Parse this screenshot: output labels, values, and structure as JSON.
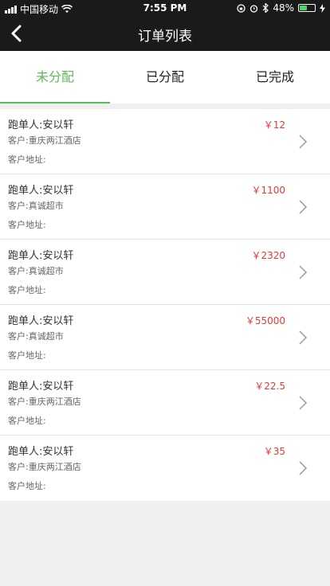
{
  "status": {
    "carrier": "中国移动",
    "time": "7:55 PM",
    "battery": "48%",
    "battery_level": 0.48
  },
  "nav": {
    "title": "订单列表"
  },
  "tabs": [
    {
      "label": "未分配",
      "active": true
    },
    {
      "label": "已分配",
      "active": false
    },
    {
      "label": "已完成",
      "active": false
    }
  ],
  "orders": [
    {
      "runner": "跑单人:安以轩",
      "customer": "客户:重庆两江酒店",
      "address": "客户地址:",
      "price": "￥12"
    },
    {
      "runner": "跑单人:安以轩",
      "customer": "客户:真诚超市",
      "address": "客户地址:",
      "price": "￥1100"
    },
    {
      "runner": "跑单人:安以轩",
      "customer": "客户:真诚超市",
      "address": "客户地址:",
      "price": "￥2320"
    },
    {
      "runner": "跑单人:安以轩",
      "customer": "客户:真诚超市",
      "address": "客户地址:",
      "price": "￥55000"
    },
    {
      "runner": "跑单人:安以轩",
      "customer": "客户:重庆两江酒店",
      "address": "客户地址:",
      "price": "￥22.5"
    },
    {
      "runner": "跑单人:安以轩",
      "customer": "客户:重庆两江酒店",
      "address": "客户地址:",
      "price": "￥35"
    }
  ],
  "colors": {
    "accent": "#5cb85c",
    "price": "#e53935",
    "navbar": "#1a1a1a",
    "battery": "#4cd964"
  }
}
